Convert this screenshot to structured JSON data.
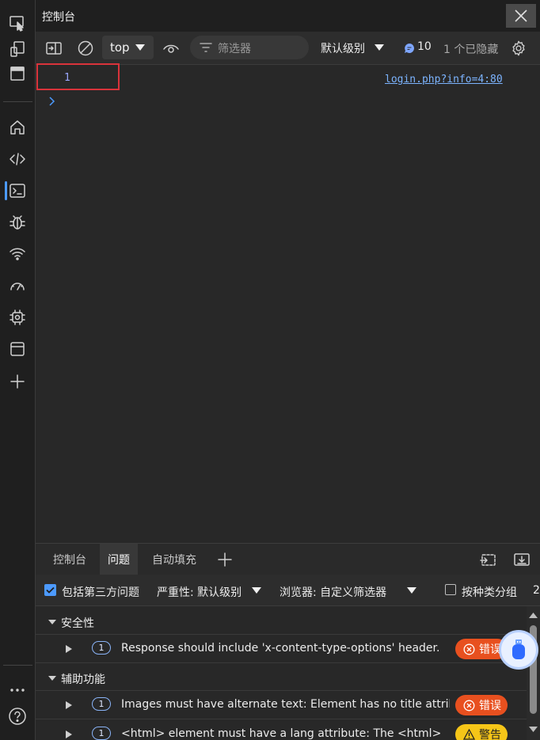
{
  "window": {
    "title": "控制台"
  },
  "toolbar": {
    "context": "top",
    "filter_placeholder": "筛选器",
    "level": "默认级别",
    "message_count": "10",
    "hidden_count": "1 个已隐藏"
  },
  "console": {
    "log_value": "1",
    "log_source": "login.php?info=4:80"
  },
  "drawer": {
    "tabs": [
      "控制台",
      "问题",
      "自动填充"
    ],
    "active_tab": "问题"
  },
  "issues_bar": {
    "include_third_party": "包括第三方问题",
    "severity": "严重性: 默认级别",
    "browser": "浏览器: 自定义筛选器",
    "group_by_kind": "按种类分组",
    "overflow_count": "2"
  },
  "issues": {
    "categories": [
      {
        "label": "安全性",
        "items": [
          {
            "count": "1",
            "text": "Response should include 'x-content-type-options' header.",
            "badge": "错误",
            "severity": "error"
          }
        ]
      },
      {
        "label": "辅助功能",
        "items": [
          {
            "count": "1",
            "text": "Images must have alternate text: Element has no title attribute",
            "badge": "错误",
            "severity": "error"
          },
          {
            "count": "1",
            "text": "<html> element must have a lang attribute: The <html>",
            "badge": "警告",
            "severity": "warning"
          }
        ]
      }
    ]
  },
  "colors": {
    "accent": "#4c9aff",
    "error": "#e8501f",
    "warning": "#f5c518",
    "highlight_box": "#d9333b"
  }
}
